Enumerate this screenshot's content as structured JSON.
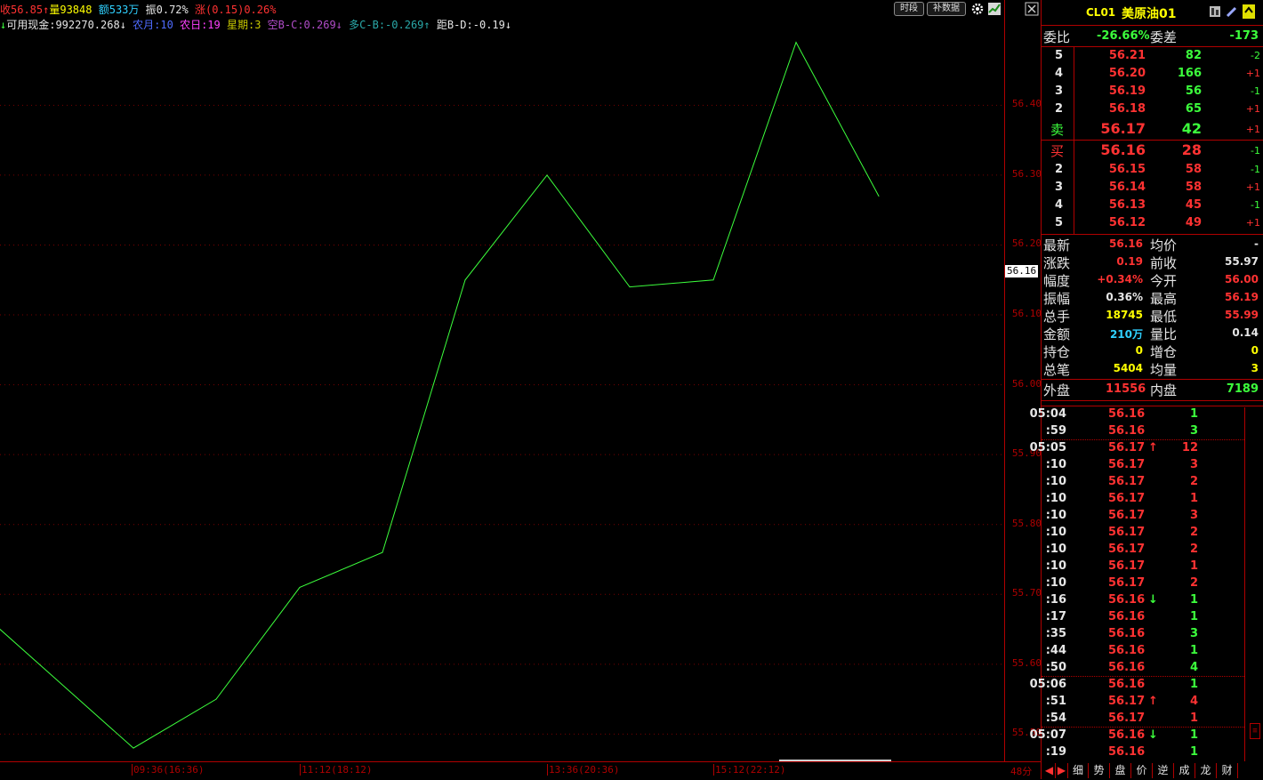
{
  "header": {
    "line1": [
      {
        "text": "收56.85↑",
        "cls": "red"
      },
      {
        "text": "量93848 ",
        "cls": "yellow"
      },
      {
        "text": "额533万 ",
        "cls": "cyan"
      },
      {
        "text": "振0.72% ",
        "cls": "white"
      },
      {
        "text": "涨(0.15)0.26%",
        "cls": "red"
      }
    ],
    "line2": [
      {
        "text": "↓",
        "cls": "green"
      },
      {
        "text": "可用现金:992270.268↓ ",
        "cls": "white"
      },
      {
        "text": "农月:10 ",
        "cls": "blue"
      },
      {
        "text": "农日:19 ",
        "cls": "magenta"
      },
      {
        "text": "星期:3 ",
        "cls": "olive"
      },
      {
        "text": "空B-C:0.269↓ ",
        "cls": "purple"
      },
      {
        "text": "多C-B:-0.269↑ ",
        "cls": "teal"
      },
      {
        "text": "距B-D:-0.19↓",
        "cls": "white"
      }
    ],
    "btn_period": "时段",
    "btn_supplement": "补数据"
  },
  "chart_data": {
    "type": "line",
    "x": [
      "09:36(16:36)",
      "",
      "",
      "",
      "11:12(18:12)",
      "",
      "",
      "13:36(20:36)",
      "",
      "",
      "15:12(22:12)",
      ""
    ],
    "series": [
      {
        "values": [
          55.65,
          55.48,
          55.55,
          55.71,
          55.76,
          56.15,
          56.3,
          56.14,
          56.15,
          56.49,
          56.27
        ]
      }
    ],
    "yticks": [
      "56.40",
      "56.30",
      "56.20",
      "56.10",
      "56.00",
      "55.90",
      "55.80",
      "55.70",
      "55.60",
      "55.50"
    ],
    "ylim": [
      55.46,
      56.54
    ],
    "xticks": [
      "09:36(16:36)",
      "11:12(18:12)",
      "13:36(20:36)",
      "15:12(22:12)"
    ],
    "current_price": "56.16",
    "period_label": "48分",
    "line_color": "#3cff3c",
    "grid": true
  },
  "panel": {
    "code": "CL01",
    "name": "美原油01",
    "weibi_label": "委比",
    "weibi": "-26.66%",
    "weicha_label": "委差",
    "weicha": "-173",
    "asks": [
      {
        "lvl": "5",
        "price": "56.21",
        "vol": "82",
        "chg": "-2"
      },
      {
        "lvl": "4",
        "price": "56.20",
        "vol": "166",
        "chg": "+1"
      },
      {
        "lvl": "3",
        "price": "56.19",
        "vol": "56",
        "chg": "-1"
      },
      {
        "lvl": "2",
        "price": "56.18",
        "vol": "65",
        "chg": "+1"
      },
      {
        "lvl": "卖",
        "price": "56.17",
        "vol": "42",
        "chg": "+1"
      }
    ],
    "bids": [
      {
        "lvl": "买",
        "price": "56.16",
        "vol": "28",
        "chg": "-1"
      },
      {
        "lvl": "2",
        "price": "56.15",
        "vol": "58",
        "chg": "-1"
      },
      {
        "lvl": "3",
        "price": "56.14",
        "vol": "58",
        "chg": "+1"
      },
      {
        "lvl": "4",
        "price": "56.13",
        "vol": "45",
        "chg": "-1"
      },
      {
        "lvl": "5",
        "price": "56.12",
        "vol": "49",
        "chg": "+1"
      }
    ],
    "stats": [
      {
        "l1": "最新",
        "v1": "56.16",
        "c1": "red",
        "l2": "均价",
        "v2": "-",
        "c2": "white"
      },
      {
        "l1": "涨跌",
        "v1": "0.19",
        "c1": "red",
        "l2": "前收",
        "v2": "55.97",
        "c2": "white"
      },
      {
        "l1": "幅度",
        "v1": "+0.34%",
        "c1": "red",
        "l2": "今开",
        "v2": "56.00",
        "c2": "red"
      },
      {
        "l1": "振幅",
        "v1": "0.36%",
        "c1": "white",
        "l2": "最高",
        "v2": "56.19",
        "c2": "red"
      },
      {
        "l1": "总手",
        "v1": "18745",
        "c1": "yellow",
        "l2": "最低",
        "v2": "55.99",
        "c2": "red"
      },
      {
        "l1": "金额",
        "v1": "210万",
        "c1": "cyan",
        "l2": "量比",
        "v2": "0.14",
        "c2": "white"
      },
      {
        "l1": "持仓",
        "v1": "0",
        "c1": "yellow",
        "l2": "增仓",
        "v2": "0",
        "c2": "yellow"
      },
      {
        "l1": "总笔",
        "v1": "5404",
        "c1": "yellow",
        "l2": "均量",
        "v2": "3",
        "c2": "yellow"
      }
    ],
    "outer_label": "外盘",
    "outer": "11556",
    "inner_label": "内盘",
    "inner": "7189",
    "ticks": [
      {
        "t": "05:04",
        "p": "56.16",
        "pc": "red",
        "a": "",
        "v": "1",
        "vc": "green",
        "sep": false
      },
      {
        "t": ":59",
        "p": "56.16",
        "pc": "red",
        "a": "",
        "v": "3",
        "vc": "green",
        "sep": true
      },
      {
        "t": "05:05",
        "p": "56.17",
        "pc": "red",
        "a": "↑",
        "ac": "red",
        "v": "12",
        "vc": "red",
        "sep": false
      },
      {
        "t": ":10",
        "p": "56.17",
        "pc": "red",
        "a": "",
        "v": "3",
        "vc": "red",
        "sep": false
      },
      {
        "t": ":10",
        "p": "56.17",
        "pc": "red",
        "a": "",
        "v": "2",
        "vc": "red",
        "sep": false
      },
      {
        "t": ":10",
        "p": "56.17",
        "pc": "red",
        "a": "",
        "v": "1",
        "vc": "red",
        "sep": false
      },
      {
        "t": ":10",
        "p": "56.17",
        "pc": "red",
        "a": "",
        "v": "3",
        "vc": "red",
        "sep": false
      },
      {
        "t": ":10",
        "p": "56.17",
        "pc": "red",
        "a": "",
        "v": "2",
        "vc": "red",
        "sep": false
      },
      {
        "t": ":10",
        "p": "56.17",
        "pc": "red",
        "a": "",
        "v": "2",
        "vc": "red",
        "sep": false
      },
      {
        "t": ":10",
        "p": "56.17",
        "pc": "red",
        "a": "",
        "v": "1",
        "vc": "red",
        "sep": false
      },
      {
        "t": ":10",
        "p": "56.17",
        "pc": "red",
        "a": "",
        "v": "2",
        "vc": "red",
        "sep": false
      },
      {
        "t": ":16",
        "p": "56.16",
        "pc": "red",
        "a": "↓",
        "ac": "green",
        "v": "1",
        "vc": "green",
        "sep": false
      },
      {
        "t": ":17",
        "p": "56.16",
        "pc": "red",
        "a": "",
        "v": "1",
        "vc": "green",
        "sep": false
      },
      {
        "t": ":35",
        "p": "56.16",
        "pc": "red",
        "a": "",
        "v": "3",
        "vc": "green",
        "sep": false
      },
      {
        "t": ":44",
        "p": "56.16",
        "pc": "red",
        "a": "",
        "v": "1",
        "vc": "green",
        "sep": false
      },
      {
        "t": ":50",
        "p": "56.16",
        "pc": "red",
        "a": "",
        "v": "4",
        "vc": "green",
        "sep": true
      },
      {
        "t": "05:06",
        "p": "56.16",
        "pc": "red",
        "a": "",
        "v": "1",
        "vc": "green",
        "sep": false
      },
      {
        "t": ":51",
        "p": "56.17",
        "pc": "red",
        "a": "↑",
        "ac": "red",
        "v": "4",
        "vc": "red",
        "sep": false
      },
      {
        "t": ":54",
        "p": "56.17",
        "pc": "red",
        "a": "",
        "v": "1",
        "vc": "red",
        "sep": true
      },
      {
        "t": "05:07",
        "p": "56.16",
        "pc": "red",
        "a": "↓",
        "ac": "green",
        "v": "1",
        "vc": "green",
        "sep": false
      },
      {
        "t": ":19",
        "p": "56.16",
        "pc": "red",
        "a": "",
        "v": "1",
        "vc": "green",
        "sep": false
      }
    ],
    "tabs": [
      "◀",
      "▶",
      "细",
      "势",
      "盘",
      "价",
      "逆",
      "成",
      "龙",
      "财"
    ]
  }
}
